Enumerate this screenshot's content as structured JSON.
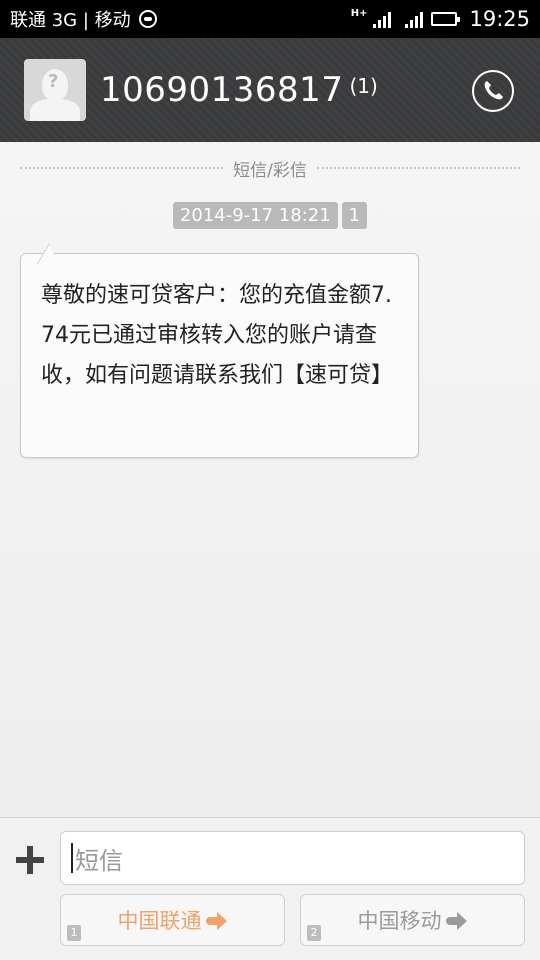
{
  "status_bar": {
    "carrier": "联通 3G | 移动",
    "network": "H+",
    "time": "19:25"
  },
  "header": {
    "contact_number": "10690136817",
    "message_count": "(1)",
    "call_icon": "phone-icon"
  },
  "conversation": {
    "section_label": "短信/彩信",
    "timestamp": "2014-9-17 18:21",
    "sim_badge": "1",
    "messages": [
      {
        "text": "尊敬的速可贷客户：您的充值金额7.74元已通过审核转入您的账户请查收，如有问题请联系我们【速可贷】"
      }
    ]
  },
  "compose": {
    "placeholder": "短信",
    "send_sim1": {
      "label": "中国联通",
      "sim": "1",
      "color": "#f0a26c"
    },
    "send_sim2": {
      "label": "中国移动",
      "sim": "2",
      "color": "#9b9b9b"
    }
  }
}
